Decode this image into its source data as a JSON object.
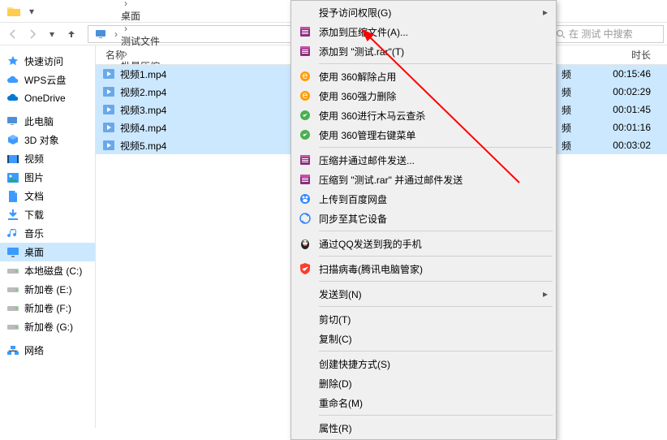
{
  "breadcrumb": {
    "segments": [
      "此电脑",
      "桌面",
      "测试文件",
      "批量压缩"
    ],
    "search_placeholder": "在 测试 中搜索"
  },
  "sidebar": {
    "groups": [
      {
        "items": [
          {
            "label": "快速访问",
            "icon": "star",
            "color": "#3b9bff"
          },
          {
            "label": "WPS云盘",
            "icon": "cloud",
            "color": "#3b9bff"
          },
          {
            "label": "OneDrive",
            "icon": "cloud",
            "color": "#0078d4"
          }
        ]
      },
      {
        "items": [
          {
            "label": "此电脑",
            "icon": "pc",
            "color": "#555"
          },
          {
            "label": "3D 对象",
            "icon": "cube",
            "color": "#3b9bff"
          },
          {
            "label": "视频",
            "icon": "video",
            "color": "#3b9bff"
          },
          {
            "label": "图片",
            "icon": "image",
            "color": "#3b9bff"
          },
          {
            "label": "文档",
            "icon": "doc",
            "color": "#3b9bff"
          },
          {
            "label": "下载",
            "icon": "download",
            "color": "#3b9bff"
          },
          {
            "label": "音乐",
            "icon": "music",
            "color": "#3b9bff"
          },
          {
            "label": "桌面",
            "icon": "desktop",
            "color": "#3b9bff",
            "selected": true
          },
          {
            "label": "本地磁盘 (C:)",
            "icon": "drive",
            "color": "#888"
          },
          {
            "label": "新加卷 (E:)",
            "icon": "drive",
            "color": "#888"
          },
          {
            "label": "新加卷 (F:)",
            "icon": "drive",
            "color": "#888"
          },
          {
            "label": "新加卷 (G:)",
            "icon": "drive",
            "color": "#888"
          }
        ]
      },
      {
        "items": [
          {
            "label": "网络",
            "icon": "network",
            "color": "#3b9bff"
          }
        ]
      }
    ]
  },
  "columns": {
    "name": "名称",
    "duration": "时长",
    "type_suffix": "频"
  },
  "files": [
    {
      "name": "视频1.mp4",
      "duration": "00:15:46",
      "selected": true
    },
    {
      "name": "视频2.mp4",
      "duration": "00:02:29",
      "selected": true
    },
    {
      "name": "视频3.mp4",
      "duration": "00:01:45",
      "selected": true
    },
    {
      "name": "视频4.mp4",
      "duration": "00:01:16",
      "selected": true
    },
    {
      "name": "视频5.mp4",
      "duration": "00:03:02",
      "selected": true
    }
  ],
  "context_menu": [
    {
      "label": "授予访问权限(G)",
      "icon": null,
      "submenu": true
    },
    {
      "label": "添加到压缩文件(A)...",
      "icon": "rar"
    },
    {
      "label": "添加到 \"测试.rar\"(T)",
      "icon": "rar"
    },
    {
      "sep": true
    },
    {
      "label": "使用 360解除占用",
      "icon": "360"
    },
    {
      "label": "使用 360强力删除",
      "icon": "360"
    },
    {
      "label": "使用 360进行木马云查杀",
      "icon": "360g"
    },
    {
      "label": "使用 360管理右键菜单",
      "icon": "360g"
    },
    {
      "sep": true
    },
    {
      "label": "压缩并通过邮件发送...",
      "icon": "rar"
    },
    {
      "label": "压缩到 \"测试.rar\" 并通过邮件发送",
      "icon": "rar"
    },
    {
      "label": "上传到百度网盘",
      "icon": "baidu"
    },
    {
      "label": "同步至其它设备",
      "icon": "sync"
    },
    {
      "sep": true
    },
    {
      "label": "通过QQ发送到我的手机",
      "icon": "qq"
    },
    {
      "sep": true
    },
    {
      "label": "扫描病毒(腾讯电脑管家)",
      "icon": "shield"
    },
    {
      "sep": true
    },
    {
      "label": "发送到(N)",
      "icon": null,
      "submenu": true
    },
    {
      "sep": true
    },
    {
      "label": "剪切(T)",
      "icon": null
    },
    {
      "label": "复制(C)",
      "icon": null
    },
    {
      "sep": true
    },
    {
      "label": "创建快捷方式(S)",
      "icon": null
    },
    {
      "label": "删除(D)",
      "icon": null
    },
    {
      "label": "重命名(M)",
      "icon": null
    },
    {
      "sep": true
    },
    {
      "label": "属性(R)",
      "icon": null
    }
  ]
}
